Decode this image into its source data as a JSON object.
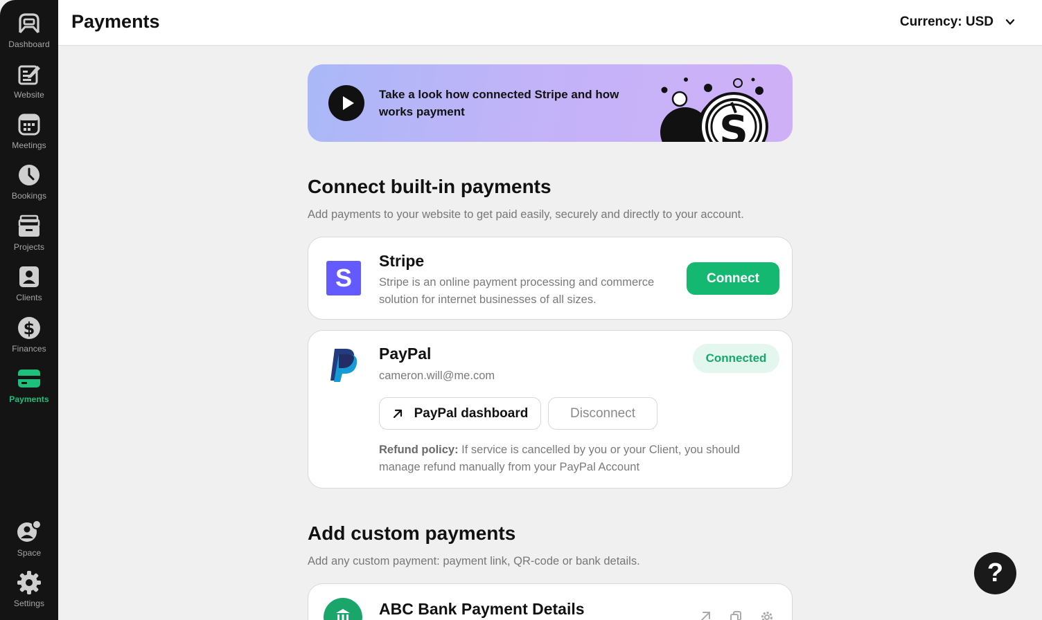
{
  "sidebar": {
    "items": [
      {
        "label": "Dashboard",
        "icon": "dashboard-icon"
      },
      {
        "label": "Website",
        "icon": "website-edit-icon"
      },
      {
        "label": "Meetings",
        "icon": "calendar-icon"
      },
      {
        "label": "Bookings",
        "icon": "clock-icon"
      },
      {
        "label": "Projects",
        "icon": "folder-icon"
      },
      {
        "label": "Clients",
        "icon": "client-contact-icon"
      },
      {
        "label": "Finances",
        "icon": "dollar-coin-icon"
      },
      {
        "label": "Payments",
        "icon": "credit-card-icon",
        "active": true
      },
      {
        "label": "Space",
        "icon": "space-user-icon"
      },
      {
        "label": "Settings",
        "icon": "gear-icon"
      }
    ],
    "active_color": "#1dbf7a"
  },
  "header": {
    "title": "Payments",
    "currency_label": "Currency: USD"
  },
  "banner": {
    "text": "Take a look how connected Stripe and how works payment"
  },
  "builtin": {
    "title": "Connect built-in payments",
    "description": "Add payments to your website to get paid easily, securely and directly to your account."
  },
  "stripe": {
    "logo_letter": "S",
    "name": "Stripe",
    "description": "Stripe is an online payment processing and commerce solution for internet businesses of all sizes.",
    "button": "Connect",
    "brand_color": "#635bff"
  },
  "paypal": {
    "name": "PayPal",
    "email": "cameron.will@me.com",
    "status": "Connected",
    "dashboard_button": "PayPal dashboard",
    "disconnect_button": "Disconnect",
    "refund_label": "Refund policy:",
    "refund_text": " If service is cancelled by you or your Client, you should manage refund manually from your PayPal Account"
  },
  "custom": {
    "title": "Add custom payments",
    "description": "Add any custom payment: payment link, QR-code or bank details."
  },
  "bank": {
    "name": "ABC Bank Payment Details"
  },
  "help": {
    "label": "?"
  }
}
